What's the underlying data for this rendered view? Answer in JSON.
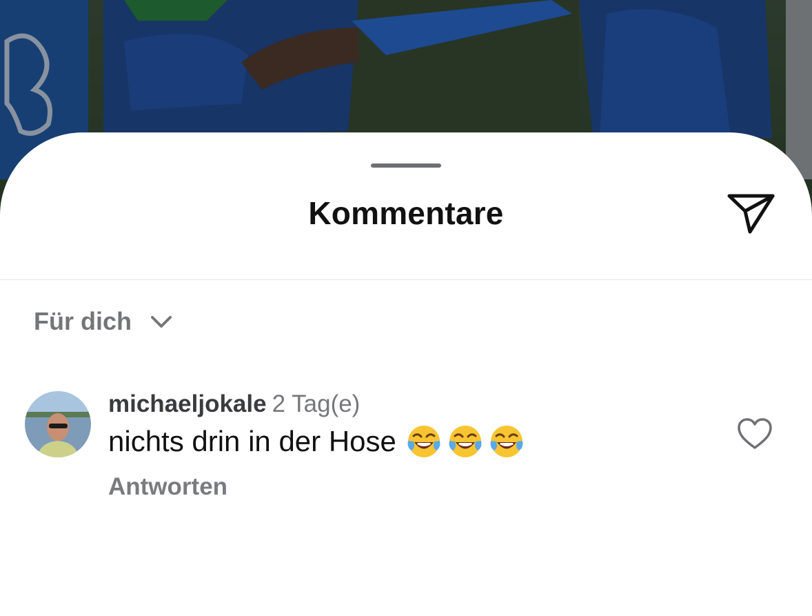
{
  "sheet": {
    "title": "Kommentare",
    "share_icon": "paper-plane-icon"
  },
  "sort": {
    "label": "Für dich",
    "chevron_icon": "chevron-down-icon"
  },
  "comments": [
    {
      "username": "michaeljokale",
      "timestamp": "2 Tag(e)",
      "text": "nichts drin in der Hose",
      "emojis": [
        "😂",
        "😂",
        "😂"
      ],
      "reply_label": "Antworten",
      "like_icon": "heart-outline-icon"
    }
  ],
  "colors": {
    "title": "#111111",
    "muted": "#737579",
    "divider": "#e3e3e6",
    "grabber": "#6e6f73"
  }
}
